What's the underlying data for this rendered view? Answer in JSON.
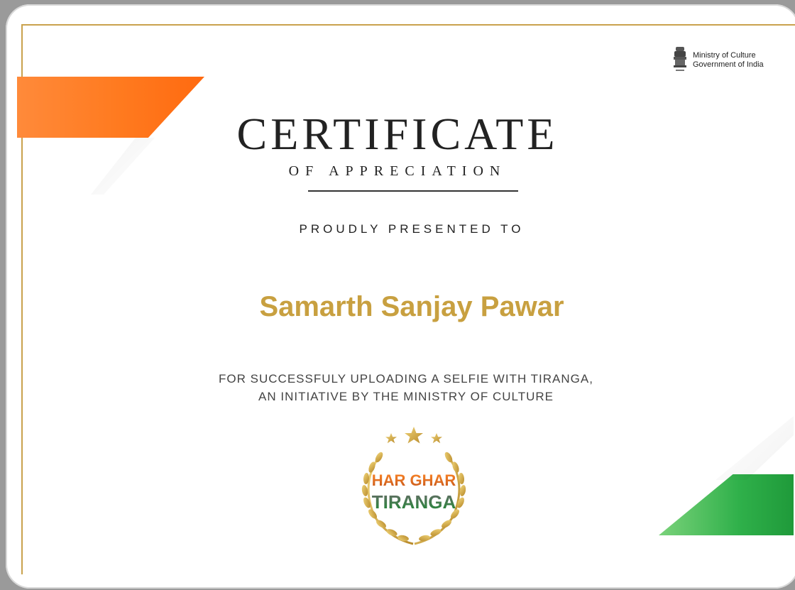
{
  "ministry": {
    "line1": "Ministry of Culture",
    "line2": "Government of India"
  },
  "certificate": {
    "title": "CERTIFICATE",
    "subtitle": "OF APPRECIATION",
    "presented_to": "PROUDLY PRESENTED TO",
    "recipient_name": "Samarth Sanjay Pawar",
    "reason_line1": "FOR SUCCESSFULY UPLOADING A SELFIE WITH TIRANGA,",
    "reason_line2": "AN INITIATIVE BY THE MINISTRY OF CULTURE"
  },
  "logo": {
    "line1": "HAR GHAR",
    "line2": "TIRANGA"
  },
  "colors": {
    "gold": "#c9a24d",
    "saffron": "#ff7a1f",
    "green": "#2fb04a",
    "name_gold": "#c8a040"
  }
}
